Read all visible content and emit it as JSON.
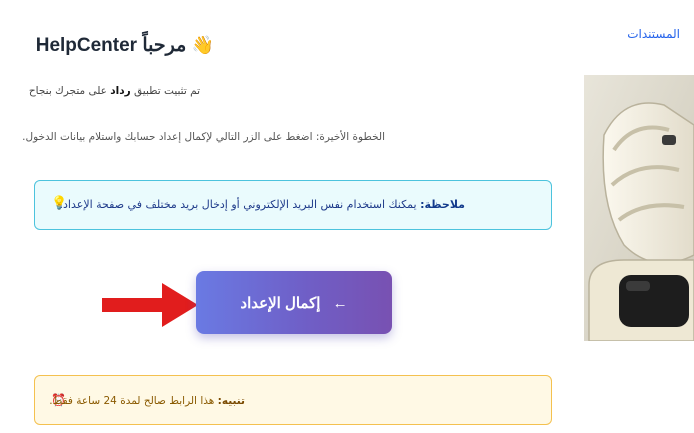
{
  "header": {
    "title": "مرحباً HelpCenter",
    "wave_emoji": "👋"
  },
  "body": {
    "installed_prefix": "تم تثبيت تطبيق ",
    "app_name": "رداد",
    "installed_suffix": " على متجرك بنجاح",
    "final_step": "الخطوة الأخيرة: اضغط على الزر التالي لإكمال إعداد حسابك واستلام بيانات الدخول."
  },
  "note": {
    "label": "ملاحظة:",
    "text": " يمكنك استخدام نفس البريد الإلكتروني أو إدخال بريد مختلف في صفحة الإعداد.",
    "icon": "lightbulb-icon"
  },
  "cta": {
    "label": "إكمال الإعداد",
    "arrow": "←"
  },
  "warning": {
    "label": "تنبيه:",
    "text": " هذا الرابط صالح لمدة 24 ساعة فقط.",
    "icon": "alarm-clock-icon"
  },
  "nav": {
    "docs": "المستندات",
    "separator": "ا"
  },
  "colors": {
    "accent": "#2563eb",
    "note_border": "#4cc3dd",
    "warning_border": "#f4c14f",
    "arrow": "#e11d1d"
  }
}
